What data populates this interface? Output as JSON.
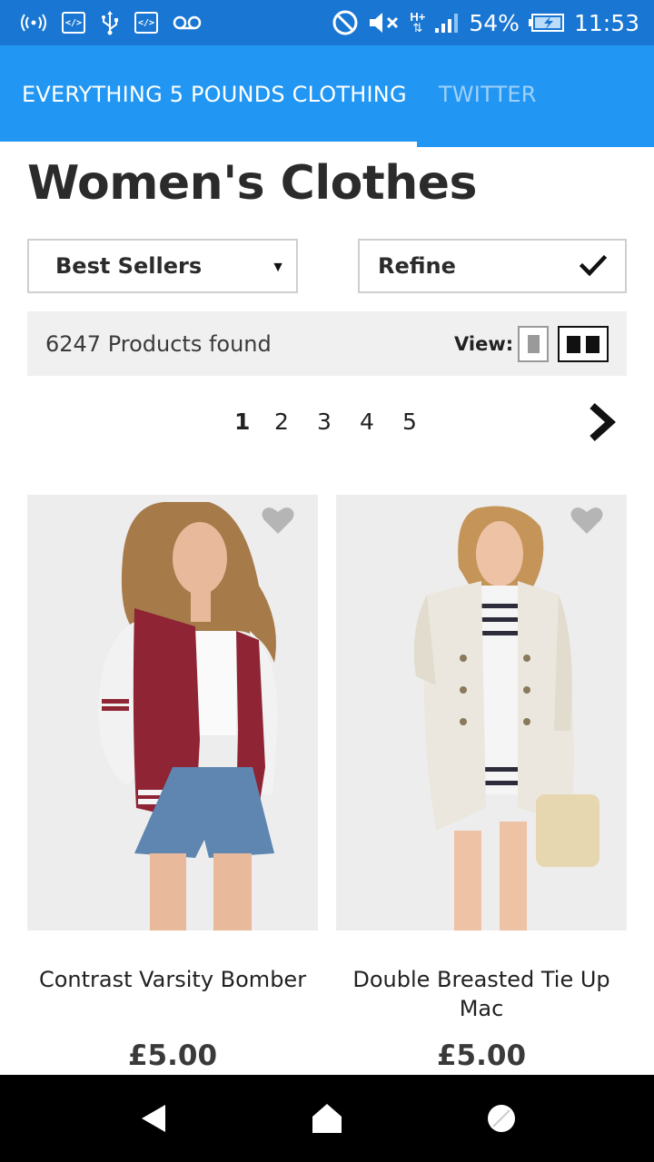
{
  "status_bar": {
    "battery": "54%",
    "time": "11:53",
    "network_type": "H+",
    "icons_left": [
      "wifi-hotspot-icon",
      "code-icon",
      "usb-icon",
      "code-icon",
      "voicemail-icon"
    ],
    "icons_right": [
      "do-not-disturb-icon",
      "mute-icon",
      "network-icon",
      "signal-icon",
      "battery-charging-icon"
    ]
  },
  "app_bar": {
    "tabs": [
      {
        "label": "EVERYTHING 5 POUNDS CLOTHING",
        "active": true
      },
      {
        "label": "TWITTER",
        "active": false
      }
    ],
    "color": "#2196f3"
  },
  "page": {
    "title": "Women's Clothes"
  },
  "controls": {
    "sort_label": "Best Sellers",
    "refine_label": "Refine"
  },
  "results": {
    "count_text": "6247 Products found",
    "view_label": "View:",
    "view_modes": [
      "single-column",
      "two-column"
    ],
    "selected_view": "two-column"
  },
  "pagination": {
    "pages": [
      "1",
      "2",
      "3",
      "4",
      "5"
    ],
    "current": "1"
  },
  "products": [
    {
      "name": "Contrast Varsity Bomber",
      "price": "£5.00"
    },
    {
      "name": "Double Breasted Tie Up Mac",
      "price": "£5.00"
    }
  ],
  "nav_bar": {
    "buttons": [
      "back-icon",
      "home-icon",
      "recents-icon"
    ]
  }
}
